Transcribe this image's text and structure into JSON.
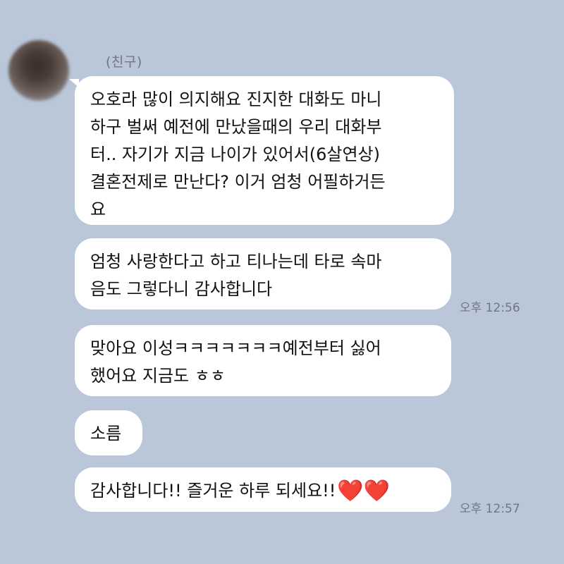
{
  "chat": {
    "sender_name": "(친구)",
    "messages": [
      {
        "lines": [
          "오호라 많이 의지해요 진지한 대화도 마니",
          "하구 벌써 예전에 만났을때의 우리 대화부",
          "터.. 자기가 지금 나이가 있어서(6살연상)",
          "결혼전제로 만난다? 이거 엄청 어필하거든",
          "요"
        ]
      },
      {
        "lines": [
          "엄청 사랑한다고 하고 티나는데 타로 속마",
          "음도 그렇다니 감사합니다"
        ],
        "time": "오후 12:56"
      },
      {
        "lines": [
          "맞아요 이성ㅋㅋㅋㅋㅋㅋㅋ예전부터 싫어",
          "했어요 지금도 ㅎㅎ"
        ]
      },
      {
        "lines": [
          "소름"
        ]
      },
      {
        "text": "감사합니다!! 즐거운 하루 되세요!!",
        "emoji": "❤️❤️",
        "time": "오후 12:57"
      }
    ]
  },
  "colors": {
    "background": "#bac7d9",
    "bubble": "#ffffff",
    "heart": "#e0312d"
  }
}
